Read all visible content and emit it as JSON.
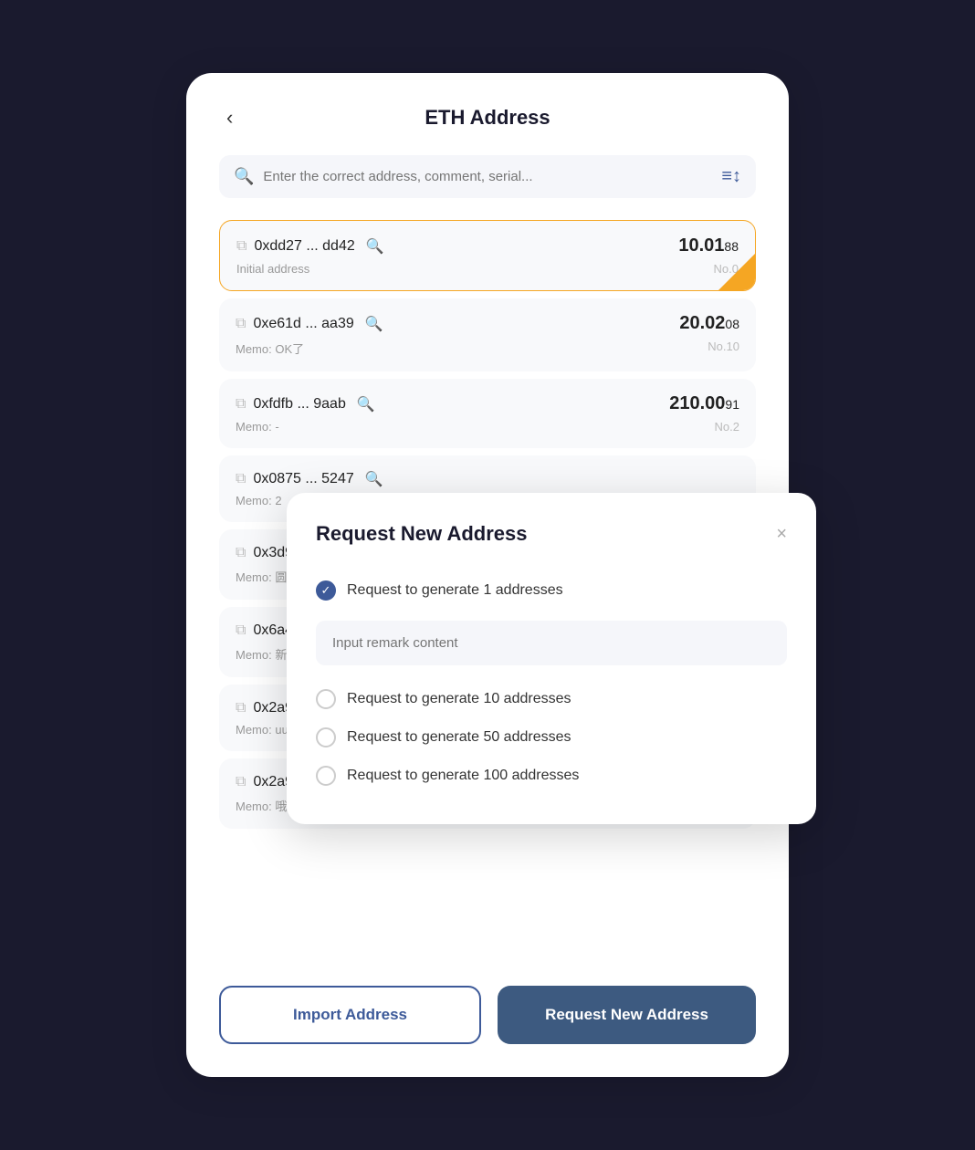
{
  "header": {
    "back_label": "‹",
    "title": "ETH Address"
  },
  "search": {
    "placeholder": "Enter the correct address, comment, serial..."
  },
  "filter_icon": "≡↕",
  "addresses": [
    {
      "address": "0xdd27 ... dd42",
      "memo": "Initial address",
      "amount_main": "10.01",
      "amount_small": "88",
      "no": "No.0",
      "active": true
    },
    {
      "address": "0xe61d ... aa39",
      "memo": "Memo: OK了",
      "amount_main": "20.02",
      "amount_small": "08",
      "no": "No.10",
      "active": false
    },
    {
      "address": "0xfdfb ... 9aab",
      "memo": "Memo: -",
      "amount_main": "210.00",
      "amount_small": "91",
      "no": "No.2",
      "active": false
    },
    {
      "address": "0x0875 ... 5247",
      "memo": "Memo: 2",
      "amount_main": "",
      "amount_small": "",
      "no": "",
      "active": false
    },
    {
      "address": "0x3d9f ... 8d06",
      "memo": "Memo: 圆112",
      "amount_main": "",
      "amount_small": "",
      "no": "",
      "active": false
    },
    {
      "address": "0x6a4a ... 0be3",
      "memo": "Memo: 新1",
      "amount_main": "",
      "amount_small": "",
      "no": "",
      "active": false
    },
    {
      "address": "0x2a9c ... a904",
      "memo": "Memo: uu",
      "amount_main": "",
      "amount_small": "",
      "no": "",
      "active": false
    },
    {
      "address": "0x2a93 ... 2006",
      "memo": "Memo: 哦哦",
      "amount_main": "",
      "amount_small": "",
      "no": "",
      "active": false
    }
  ],
  "buttons": {
    "import": "Import Address",
    "request": "Request New Address"
  },
  "dialog": {
    "title": "Request New Address",
    "close": "×",
    "options": [
      {
        "label": "Request to generate 1 addresses",
        "checked": true
      },
      {
        "label": "Request to generate 10 addresses",
        "checked": false
      },
      {
        "label": "Request to generate 50 addresses",
        "checked": false
      },
      {
        "label": "Request to generate 100 addresses",
        "checked": false
      }
    ],
    "remark_placeholder": "Input remark content"
  }
}
